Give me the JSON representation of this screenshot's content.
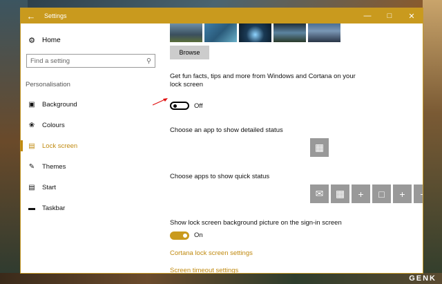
{
  "window": {
    "title": "Settings"
  },
  "sidebar": {
    "home_label": "Home",
    "search_placeholder": "Find a setting",
    "section_label": "Personalisation",
    "items": [
      {
        "label": "Background",
        "icon": "picture-icon",
        "active": false
      },
      {
        "label": "Colours",
        "icon": "palette-icon",
        "active": false
      },
      {
        "label": "Lock screen",
        "icon": "lock-screen-icon",
        "active": true
      },
      {
        "label": "Themes",
        "icon": "brush-icon",
        "active": false
      },
      {
        "label": "Start",
        "icon": "start-icon",
        "active": false
      },
      {
        "label": "Taskbar",
        "icon": "taskbar-icon",
        "active": false
      }
    ]
  },
  "main": {
    "browse_label": "Browse",
    "fun_facts_label": "Get fun facts, tips and more from Windows and Cortana on your lock screen",
    "fun_facts_state": "Off",
    "detailed_status_label": "Choose an app to show detailed status",
    "quick_status_label": "Choose apps to show quick status",
    "signin_bg_label": "Show lock screen background picture on the sign-in screen",
    "signin_bg_state": "On",
    "cortana_link": "Cortana lock screen settings",
    "timeout_link": "Screen timeout settings"
  },
  "colors": {
    "accent": "#c99a1e",
    "link": "#c08a10"
  },
  "watermark": "GENK"
}
